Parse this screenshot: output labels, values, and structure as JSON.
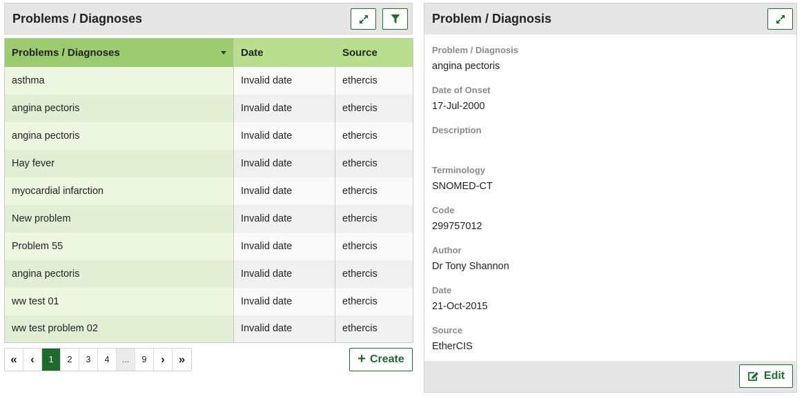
{
  "list_panel": {
    "title": "Problems / Diagnoses",
    "buttons": {
      "expand_icon": "expand-icon",
      "filter_icon": "filter-icon"
    },
    "columns": [
      "Problems / Diagnoses",
      "Date",
      "Source"
    ],
    "sort_column": "Problems / Diagnoses",
    "rows": [
      [
        "asthma",
        "Invalid date",
        "ethercis"
      ],
      [
        "angina pectoris",
        "Invalid date",
        "ethercis"
      ],
      [
        "angina pectoris",
        "Invalid date",
        "ethercis"
      ],
      [
        "Hay fever",
        "Invalid date",
        "ethercis"
      ],
      [
        "myocardial infarction",
        "Invalid date",
        "ethercis"
      ],
      [
        "New problem",
        "Invalid date",
        "ethercis"
      ],
      [
        "Problem 55",
        "Invalid date",
        "ethercis"
      ],
      [
        "angina pectoris",
        "Invalid date",
        "ethercis"
      ],
      [
        "ww test 01",
        "Invalid date",
        "ethercis"
      ],
      [
        "ww test problem 02",
        "Invalid date",
        "ethercis"
      ]
    ],
    "pagination": {
      "first": "«",
      "prev": "‹",
      "pages": [
        "1",
        "2",
        "3",
        "4",
        "...",
        "9"
      ],
      "current_page": "1",
      "next": "›",
      "last": "»"
    },
    "create_label": "Create"
  },
  "detail_panel": {
    "title": "Problem / Diagnosis",
    "fields": [
      {
        "label": "Problem / Diagnosis",
        "value": "angina pectoris"
      },
      {
        "label": "Date of Onset",
        "value": "17-Jul-2000"
      },
      {
        "label": "Description",
        "value": ""
      },
      {
        "label": "Terminology",
        "value": "SNOMED-CT"
      },
      {
        "label": "Code",
        "value": "299757012"
      },
      {
        "label": "Author",
        "value": "Dr Tony Shannon"
      },
      {
        "label": "Date",
        "value": "21-Oct-2015"
      },
      {
        "label": "Source",
        "value": "EtherCIS"
      }
    ],
    "edit_label": "Edit"
  },
  "colors": {
    "header_green": "#b9df8e",
    "sorted_header_green": "#9ccb6f",
    "accent_dark_green": "#1f6a2e",
    "panel_header_gray": "#e6e6e6",
    "label_gray": "#8a8a8a"
  }
}
